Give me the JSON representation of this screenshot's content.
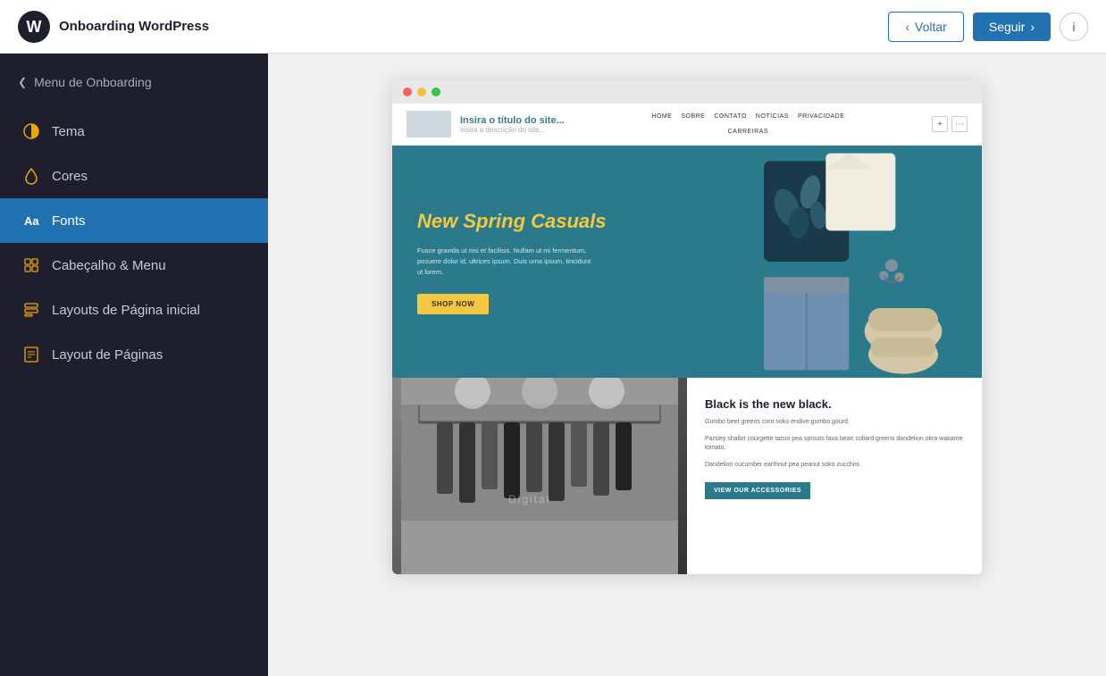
{
  "topbar": {
    "logo_alt": "WordPress Logo",
    "title": "Onboarding WordPress",
    "btn_voltar": "Voltar",
    "btn_seguir": "Seguir",
    "btn_info": "i"
  },
  "sidebar": {
    "menu_toggle": "Menu de Onboarding",
    "items": [
      {
        "id": "tema",
        "label": "Tema",
        "icon": "circle-half"
      },
      {
        "id": "cores",
        "label": "Cores",
        "icon": "droplet"
      },
      {
        "id": "fonts",
        "label": "Fonts",
        "icon": "text-aa",
        "active": true
      },
      {
        "id": "cabecalho",
        "label": "Cabeçalho & Menu",
        "icon": "layout-grid"
      },
      {
        "id": "layouts-pagina-inicial",
        "label": "Layouts de Página inicial",
        "icon": "layout-list"
      },
      {
        "id": "layout-paginas",
        "label": "Layout de Páginas",
        "icon": "layout-page"
      }
    ]
  },
  "preview": {
    "browser_dots": [
      "red",
      "yellow",
      "green"
    ],
    "site": {
      "logo_text": "",
      "title": "Insira o título do site...",
      "description": "Insira a descrição do site...",
      "nav_links_top": [
        "HOME",
        "SOBRE",
        "CONTATO",
        "NOTÍCIAS",
        "PRIVACIDADE"
      ],
      "nav_links_bottom": [
        "CARREIRAS"
      ],
      "hero": {
        "title": "New Spring Casuals",
        "text": "Fusce gravida ut nisi et facilisis. Nullam ut mi fermentum, posuere dolor id, ultrices ipsum. Duis urna ipsum, tincidunt ut lorem.",
        "cta": "Shop now"
      },
      "second_section": {
        "store_label": "Digital",
        "heading": "Black is the new black.",
        "paragraphs": [
          "Gumbo beet greens corn soko endive gumbo gourd.",
          "Parsley shallot courgette tatsoi pea sprouts fava bean collard greens dandelion okra wakame tomato.",
          "Dandelion cucumber earthnut pea peanut soko zucchini."
        ],
        "cta": "VIEW OUR ACCESSORIES"
      }
    }
  }
}
